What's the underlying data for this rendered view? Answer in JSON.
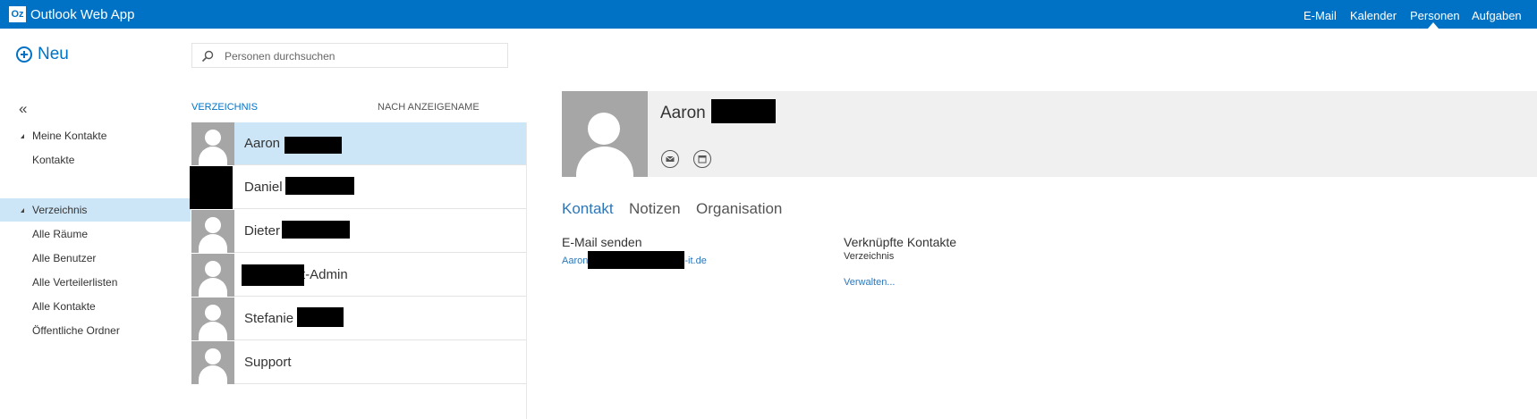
{
  "app": {
    "logo": "Oz",
    "title": "Outlook Web App"
  },
  "topnav": {
    "items": [
      "E-Mail",
      "Kalender",
      "Personen",
      "Aufgaben"
    ],
    "active": "Personen"
  },
  "new_button": {
    "label": "Neu"
  },
  "search": {
    "placeholder": "Personen durchsuchen"
  },
  "sidebar": {
    "collapse_glyph": "«",
    "items": [
      {
        "label": "Meine Kontakte",
        "expanded": true
      },
      {
        "label": "Kontakte"
      },
      {
        "label": "Verzeichnis",
        "expanded": true,
        "selected": true
      },
      {
        "label": "Alle Räume"
      },
      {
        "label": "Alle Benutzer"
      },
      {
        "label": "Alle Verteilerlisten"
      },
      {
        "label": "Alle Kontakte"
      },
      {
        "label": "Öffentliche Ordner"
      }
    ]
  },
  "list": {
    "headers": [
      "VERZEICHNIS",
      "NACH ANZEIGENAME"
    ],
    "items": [
      {
        "name": "Aaron",
        "selected": true
      },
      {
        "name": "Daniel"
      },
      {
        "name": "Dieter"
      },
      {
        "name": "t-Admin"
      },
      {
        "name": "Stefanie"
      },
      {
        "name": "Support"
      }
    ]
  },
  "detail": {
    "name": "Aaron",
    "tabs": [
      "Kontakt",
      "Notizen",
      "Organisation"
    ],
    "active_tab": "Kontakt",
    "email_label": "E-Mail senden",
    "email_prefix": "Aaron",
    "email_suffix": "-it.de",
    "linked_label": "Verknüpfte Kontakte",
    "linked_value": "Verzeichnis",
    "manage_link": "Verwalten..."
  },
  "colors": {
    "brand": "#0072c6",
    "selection": "#cde6f7",
    "header_bg": "#f0f0f0",
    "avatar": "#a6a6a6"
  }
}
